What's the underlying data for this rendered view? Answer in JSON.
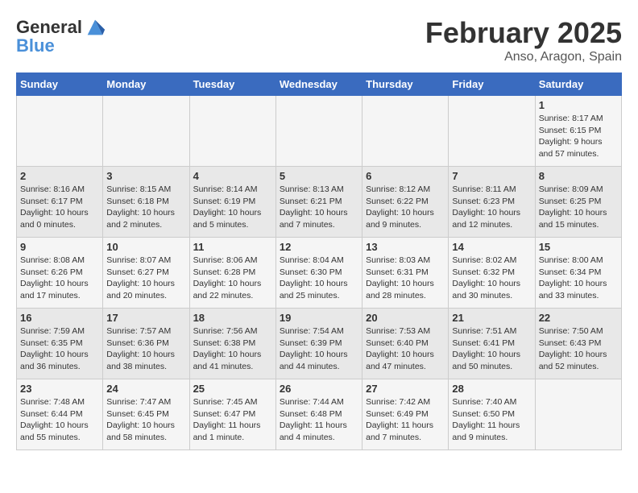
{
  "header": {
    "logo_line1": "General",
    "logo_line2": "Blue",
    "month_title": "February 2025",
    "location": "Anso, Aragon, Spain"
  },
  "days_of_week": [
    "Sunday",
    "Monday",
    "Tuesday",
    "Wednesday",
    "Thursday",
    "Friday",
    "Saturday"
  ],
  "weeks": [
    [
      {
        "day": "",
        "info": ""
      },
      {
        "day": "",
        "info": ""
      },
      {
        "day": "",
        "info": ""
      },
      {
        "day": "",
        "info": ""
      },
      {
        "day": "",
        "info": ""
      },
      {
        "day": "",
        "info": ""
      },
      {
        "day": "1",
        "info": "Sunrise: 8:17 AM\nSunset: 6:15 PM\nDaylight: 9 hours and 57 minutes."
      }
    ],
    [
      {
        "day": "2",
        "info": "Sunrise: 8:16 AM\nSunset: 6:17 PM\nDaylight: 10 hours and 0 minutes."
      },
      {
        "day": "3",
        "info": "Sunrise: 8:15 AM\nSunset: 6:18 PM\nDaylight: 10 hours and 2 minutes."
      },
      {
        "day": "4",
        "info": "Sunrise: 8:14 AM\nSunset: 6:19 PM\nDaylight: 10 hours and 5 minutes."
      },
      {
        "day": "5",
        "info": "Sunrise: 8:13 AM\nSunset: 6:21 PM\nDaylight: 10 hours and 7 minutes."
      },
      {
        "day": "6",
        "info": "Sunrise: 8:12 AM\nSunset: 6:22 PM\nDaylight: 10 hours and 9 minutes."
      },
      {
        "day": "7",
        "info": "Sunrise: 8:11 AM\nSunset: 6:23 PM\nDaylight: 10 hours and 12 minutes."
      },
      {
        "day": "8",
        "info": "Sunrise: 8:09 AM\nSunset: 6:25 PM\nDaylight: 10 hours and 15 minutes."
      }
    ],
    [
      {
        "day": "9",
        "info": "Sunrise: 8:08 AM\nSunset: 6:26 PM\nDaylight: 10 hours and 17 minutes."
      },
      {
        "day": "10",
        "info": "Sunrise: 8:07 AM\nSunset: 6:27 PM\nDaylight: 10 hours and 20 minutes."
      },
      {
        "day": "11",
        "info": "Sunrise: 8:06 AM\nSunset: 6:28 PM\nDaylight: 10 hours and 22 minutes."
      },
      {
        "day": "12",
        "info": "Sunrise: 8:04 AM\nSunset: 6:30 PM\nDaylight: 10 hours and 25 minutes."
      },
      {
        "day": "13",
        "info": "Sunrise: 8:03 AM\nSunset: 6:31 PM\nDaylight: 10 hours and 28 minutes."
      },
      {
        "day": "14",
        "info": "Sunrise: 8:02 AM\nSunset: 6:32 PM\nDaylight: 10 hours and 30 minutes."
      },
      {
        "day": "15",
        "info": "Sunrise: 8:00 AM\nSunset: 6:34 PM\nDaylight: 10 hours and 33 minutes."
      }
    ],
    [
      {
        "day": "16",
        "info": "Sunrise: 7:59 AM\nSunset: 6:35 PM\nDaylight: 10 hours and 36 minutes."
      },
      {
        "day": "17",
        "info": "Sunrise: 7:57 AM\nSunset: 6:36 PM\nDaylight: 10 hours and 38 minutes."
      },
      {
        "day": "18",
        "info": "Sunrise: 7:56 AM\nSunset: 6:38 PM\nDaylight: 10 hours and 41 minutes."
      },
      {
        "day": "19",
        "info": "Sunrise: 7:54 AM\nSunset: 6:39 PM\nDaylight: 10 hours and 44 minutes."
      },
      {
        "day": "20",
        "info": "Sunrise: 7:53 AM\nSunset: 6:40 PM\nDaylight: 10 hours and 47 minutes."
      },
      {
        "day": "21",
        "info": "Sunrise: 7:51 AM\nSunset: 6:41 PM\nDaylight: 10 hours and 50 minutes."
      },
      {
        "day": "22",
        "info": "Sunrise: 7:50 AM\nSunset: 6:43 PM\nDaylight: 10 hours and 52 minutes."
      }
    ],
    [
      {
        "day": "23",
        "info": "Sunrise: 7:48 AM\nSunset: 6:44 PM\nDaylight: 10 hours and 55 minutes."
      },
      {
        "day": "24",
        "info": "Sunrise: 7:47 AM\nSunset: 6:45 PM\nDaylight: 10 hours and 58 minutes."
      },
      {
        "day": "25",
        "info": "Sunrise: 7:45 AM\nSunset: 6:47 PM\nDaylight: 11 hours and 1 minute."
      },
      {
        "day": "26",
        "info": "Sunrise: 7:44 AM\nSunset: 6:48 PM\nDaylight: 11 hours and 4 minutes."
      },
      {
        "day": "27",
        "info": "Sunrise: 7:42 AM\nSunset: 6:49 PM\nDaylight: 11 hours and 7 minutes."
      },
      {
        "day": "28",
        "info": "Sunrise: 7:40 AM\nSunset: 6:50 PM\nDaylight: 11 hours and 9 minutes."
      },
      {
        "day": "",
        "info": ""
      }
    ]
  ]
}
